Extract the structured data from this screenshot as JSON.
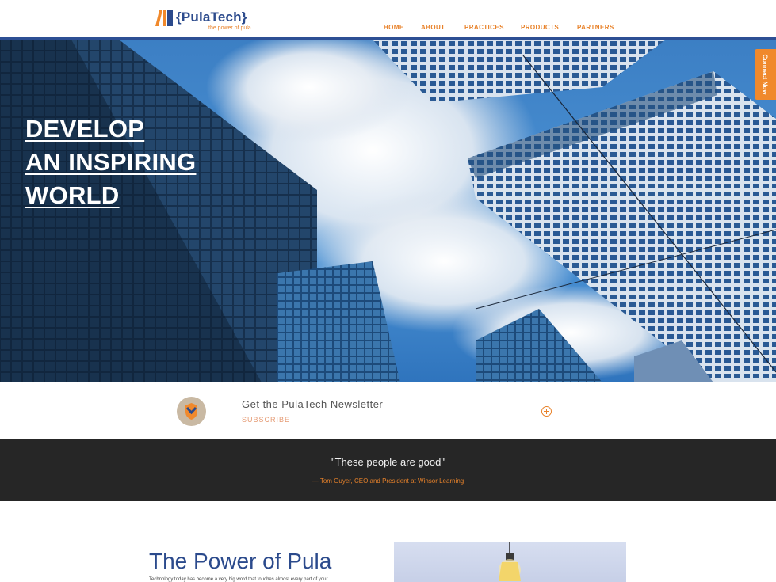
{
  "brand": {
    "name": "{PulaTech}",
    "tagline": "the power of pula",
    "colors": {
      "primary": "#2b4a8c",
      "accent": "#e8822a"
    }
  },
  "nav": {
    "items": [
      {
        "label": "HOME"
      },
      {
        "label": "ABOUT"
      },
      {
        "label": "PRACTICES"
      },
      {
        "label": "PRODUCTS"
      },
      {
        "label": "PARTNERS"
      }
    ]
  },
  "hero": {
    "lines": [
      "DEVELOP",
      "AN INSPIRING",
      "WORLD"
    ],
    "connect_label": "Connect Now"
  },
  "newsletter": {
    "title": "Get the PulaTech Newsletter",
    "subscribe_label": "SUBSCRIBE",
    "icon": "shield-badge-icon",
    "expand_icon": "plus-circle-icon"
  },
  "testimonial": {
    "quote": "\"These people are good\"",
    "author": "— Tom Guyer, CEO and President at Winsor Learning"
  },
  "section": {
    "title": "The Power of Pula",
    "body_start": "Technology today has become a very big word that touches almost every part of your",
    "image_icon": "light-bulb-icon"
  }
}
